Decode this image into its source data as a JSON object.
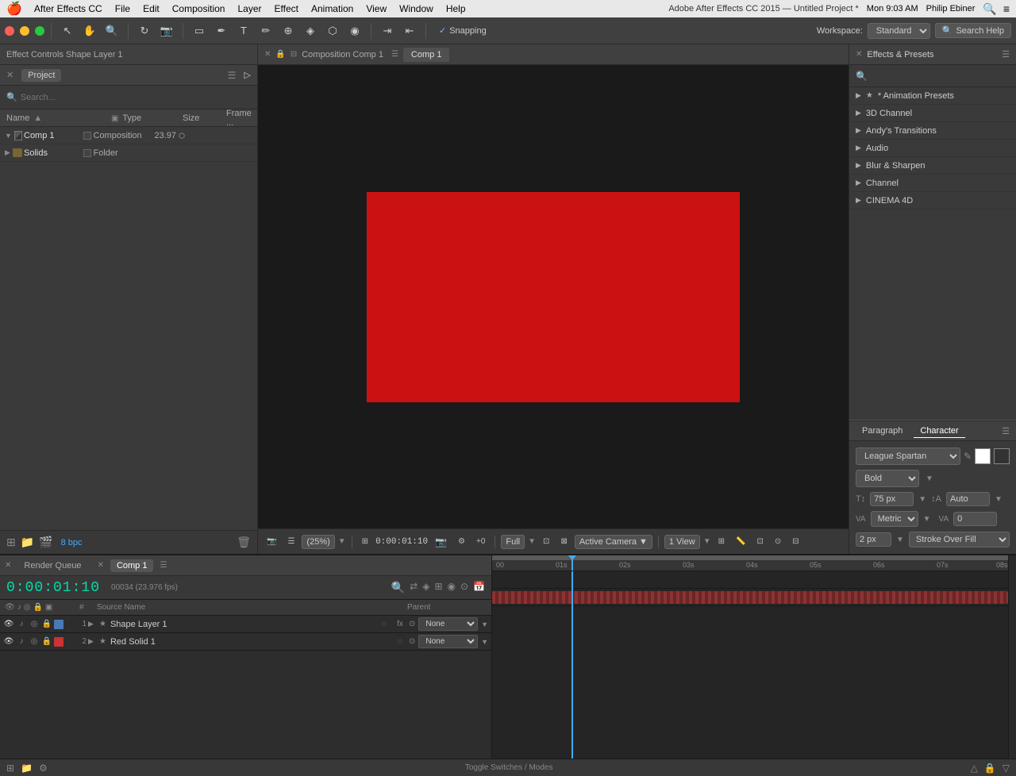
{
  "menubar": {
    "apple_icon": "🍎",
    "app_name": "After Effects CC",
    "menus": [
      "File",
      "Edit",
      "Composition",
      "Layer",
      "Effect",
      "Animation",
      "View",
      "Window",
      "Help"
    ],
    "time": "Mon 9:03 AM",
    "user": "Philip Ebiner"
  },
  "toolbar": {
    "snapping_label": "Snapping",
    "workspace_label": "Workspace:",
    "workspace_value": "Standard",
    "search_help": "Search Help"
  },
  "left_panel": {
    "effect_controls_label": "Effect Controls Shape Layer 1",
    "project_label": "Project",
    "search_placeholder": "Search...",
    "table_headers": {
      "name": "Name",
      "type": "Type",
      "size": "Size",
      "frame": "Frame ..."
    },
    "items": [
      {
        "name": "Comp 1",
        "type": "Composition",
        "size": "23.97",
        "frame": "",
        "icon": "comp"
      },
      {
        "name": "Solids",
        "type": "Folder",
        "size": "",
        "frame": "",
        "icon": "folder"
      }
    ],
    "bpc": "8 bpc"
  },
  "composition": {
    "title": "Composition Comp 1",
    "tab": "Comp 1",
    "zoom": "(25%)",
    "timecode": "0:00:01:10",
    "quality": "Full",
    "camera": "Active Camera",
    "view": "1 View",
    "canvas_color": "#cc1111"
  },
  "effects_panel": {
    "title": "Effects & Presets",
    "items": [
      {
        "label": "* Animation Presets",
        "star": true
      },
      {
        "label": "3D Channel"
      },
      {
        "label": "Andy's Transitions"
      },
      {
        "label": "Audio"
      },
      {
        "label": "Blur & Sharpen"
      },
      {
        "label": "Channel"
      },
      {
        "label": "CINEMA 4D"
      }
    ]
  },
  "character_panel": {
    "paragraph_label": "Paragraph",
    "character_label": "Character",
    "font_name": "League Spartan",
    "font_style": "Bold",
    "font_size": "75 px",
    "auto_leading": "Auto",
    "metrics_label": "Metrics",
    "tracking_value": "0",
    "stroke_size": "2 px",
    "stroke_type": "Stroke Over Fill"
  },
  "timeline": {
    "timecode": "0:00:01:10",
    "fps": "00034 (23.976 fps)",
    "tabs": [
      {
        "label": "Render Queue"
      },
      {
        "label": "Comp 1",
        "active": true
      }
    ],
    "columns": {
      "source_name": "Source Name",
      "parent": "Parent"
    },
    "layers": [
      {
        "num": "1",
        "name": "Shape Layer 1",
        "color": "#4a7ab5",
        "icon": "shape",
        "parent": "None",
        "visible": true,
        "audio": false
      },
      {
        "num": "2",
        "name": "Red Solid 1",
        "color": "#cc3333",
        "icon": "solid",
        "parent": "None",
        "visible": true,
        "audio": false
      }
    ],
    "ruler_marks": [
      "00",
      "01s",
      "02s",
      "03s",
      "04s",
      "05s",
      "06s",
      "07s",
      "08s"
    ],
    "playhead_position": "18",
    "bottom_bar": {
      "toggle_label": "Toggle Switches / Modes"
    }
  }
}
